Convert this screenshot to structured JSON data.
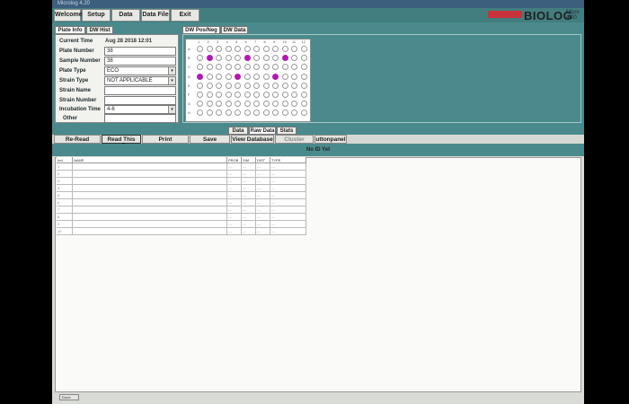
{
  "window": {
    "title": "Microlog 4.20"
  },
  "menu": [
    {
      "label": "Welcome"
    },
    {
      "label": "Setup"
    },
    {
      "label": "Data"
    },
    {
      "label": "Data File"
    },
    {
      "label": "Exit"
    }
  ],
  "brand": {
    "logo": "BIOLOG",
    "side_line1": "Micro",
    "side_line2": "4.20"
  },
  "left_tabs": [
    {
      "label": "Plate Info"
    },
    {
      "label": "DW Hist"
    }
  ],
  "form": {
    "current_time_label": "Current Time",
    "current_time_value": "Aug 28 2018 12:01",
    "plate_number_label": "Plate Number",
    "plate_number_value": "38",
    "sample_number_label": "Sample Number",
    "sample_number_value": "38",
    "plate_type_label": "Plate Type",
    "plate_type_value": "ECO",
    "strain_type_label": "Strain Type",
    "strain_type_value": "NOT APPLICABLE",
    "strain_name_label": "Strain Name",
    "strain_name_value": "",
    "strain_number_label": "Strain Number",
    "strain_number_value": "",
    "incubation_label": "Incubation Time",
    "incubation_value": "4-6",
    "other_label": "Other",
    "other_value": ""
  },
  "right_tabs": [
    {
      "label": "DW Pos/Neg"
    },
    {
      "label": "DW Data"
    }
  ],
  "plate": {
    "columns": [
      "1",
      "2",
      "3",
      "4",
      "5",
      "6",
      "7",
      "8",
      "9",
      "10",
      "11",
      "12"
    ],
    "rows": [
      "A",
      "B",
      "C",
      "D",
      "E",
      "F",
      "G",
      "H"
    ],
    "positive_wells": [
      [
        1,
        1
      ],
      [
        1,
        5
      ],
      [
        1,
        9
      ],
      [
        3,
        0
      ],
      [
        3,
        4
      ],
      [
        3,
        8
      ]
    ],
    "positive_color": "#b01ab3"
  },
  "sub_tabs": [
    {
      "label": "Data"
    },
    {
      "label": "Raw Data"
    },
    {
      "label": "Stats"
    }
  ],
  "actions": {
    "reread": "Re-Read",
    "readthis": "Read This",
    "print": "Print",
    "save": "Save",
    "viewdb": "View Database",
    "cluster": "Cluster Menu",
    "panel": "uttonpanel"
  },
  "result_status": "No ID Yet",
  "table": {
    "headers": [
      "Ind.",
      "NAME",
      "PROB",
      "SIM",
      "DIST",
      "TYPE"
    ],
    "rows": [
      [
        "1",
        "",
        "---",
        "---",
        "---",
        "---"
      ],
      [
        "2",
        "",
        "---",
        "---",
        "---",
        "---"
      ],
      [
        "3",
        "",
        "---",
        "---",
        "---",
        "---"
      ],
      [
        "4",
        "",
        "---",
        "---",
        "---",
        "---"
      ],
      [
        "5",
        "",
        "---",
        "---",
        "---",
        "---"
      ],
      [
        "6",
        "",
        "---",
        "---",
        "---",
        "---"
      ],
      [
        "7",
        "",
        "---",
        "---",
        "---",
        "---"
      ],
      [
        "8",
        "",
        "---",
        "---",
        "---",
        "---"
      ],
      [
        "9",
        "",
        "---",
        "---",
        "---",
        "---"
      ],
      [
        "10",
        "",
        "---",
        "---",
        "---",
        "---"
      ]
    ]
  },
  "status_bar": "Done",
  "colors": {
    "accent": "#4a8a8c",
    "menu_bar": "#427e7f",
    "title_bar": "#3d5f7e",
    "logo_red": "#c8323a"
  }
}
